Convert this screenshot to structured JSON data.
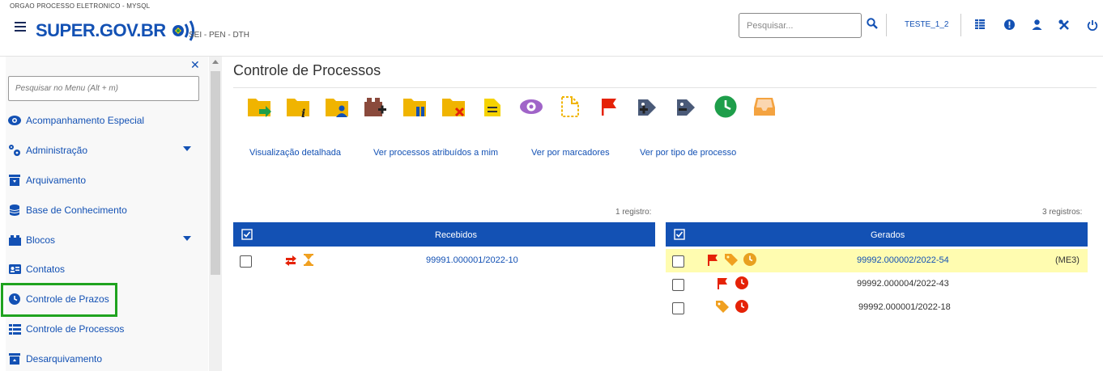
{
  "header": {
    "org_name": "ORGAO PROCESSO ELETRONICO - MYSQL",
    "logo_text": "SUPER.GOV.BR",
    "sub_label": "SEI - PEN - DTH",
    "search_placeholder": "Pesquisar...",
    "user_unit": "TESTE_1_2"
  },
  "sidebar": {
    "search_placeholder": "Pesquisar no Menu (Alt + m)",
    "items": [
      {
        "label": "Acompanhamento Especial",
        "icon": "eye-icon"
      },
      {
        "label": "Administração",
        "icon": "cogs-icon"
      },
      {
        "label": "Arquivamento",
        "icon": "archive-icon"
      },
      {
        "label": "Base de Conhecimento",
        "icon": "database-icon"
      },
      {
        "label": "Blocos",
        "icon": "blocks-icon"
      },
      {
        "label": "Contatos",
        "icon": "contact-card-icon"
      },
      {
        "label": "Controle de Prazos",
        "icon": "clock-icon"
      },
      {
        "label": "Controle de Processos",
        "icon": "list-icon"
      },
      {
        "label": "Desarquivamento",
        "icon": "unarchive-icon"
      }
    ]
  },
  "main": {
    "title": "Controle de Processos",
    "toolbar_icons": [
      "send-process-icon",
      "process-info-icon",
      "assign-process-icon",
      "add-to-block-icon",
      "suspend-process-icon",
      "close-process-icon",
      "annotation-icon",
      "mark-as-viewed-icon",
      "new-document-icon",
      "flag-icon",
      "add-marker-icon",
      "remove-marker-icon",
      "deadline-clock-icon",
      "inbox-icon"
    ],
    "view_links": [
      "Visualização detalhada",
      "Ver processos atribuídos a mim",
      "Ver por marcadores",
      "Ver por tipo de processo"
    ],
    "received": {
      "count_label": "1 registro:",
      "header": "Recebidos",
      "rows": [
        {
          "process": "99991.000001/2022-10",
          "icons": [
            "transfer-arrows-icon",
            "hourglass-icon"
          ]
        }
      ]
    },
    "generated": {
      "count_label": "3 registros:",
      "header": "Gerados",
      "rows": [
        {
          "process": "99992.000002/2022-54",
          "tag": "(ME3)",
          "icons": [
            "flag-icon",
            "tag-icon",
            "clock-icon"
          ],
          "highlight_color": "#fffcb0"
        },
        {
          "process": "99992.000004/2022-43",
          "tag": "",
          "icons": [
            "flag-icon",
            "clock-icon"
          ]
        },
        {
          "process": "99992.000001/2022-18",
          "tag": "",
          "icons": [
            "tag-icon",
            "clock-icon"
          ]
        }
      ]
    }
  },
  "colors": {
    "primary": "#1351b4",
    "highlight_border": "#1fa31f",
    "folder_yellow": "#f0b400",
    "flag_red": "#e52207",
    "tag_orange": "#f0a020",
    "clock_green": "#1e9e4a"
  }
}
